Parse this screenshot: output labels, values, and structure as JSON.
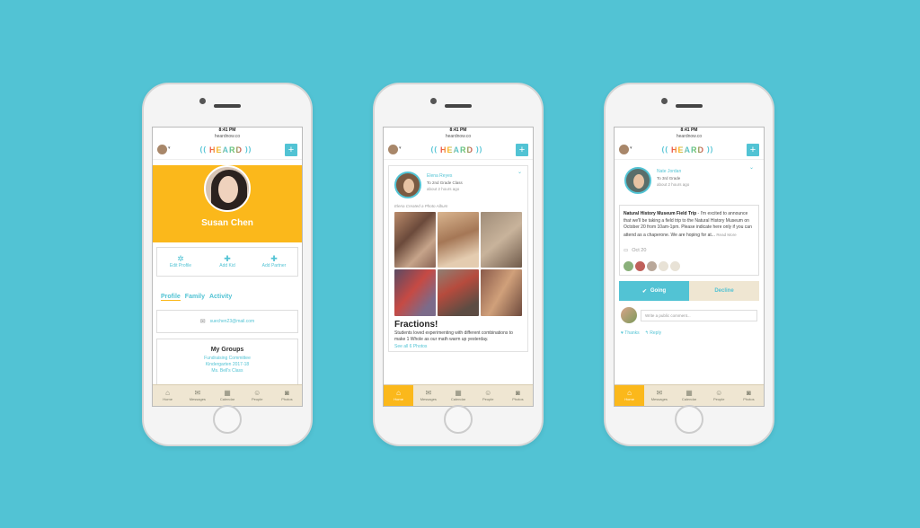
{
  "status": {
    "time": "8:41 PM",
    "url": "heardnow.co"
  },
  "logo": "HEARD",
  "plus_label": "+",
  "tabs": [
    {
      "label": "Home",
      "icon": "⌂"
    },
    {
      "label": "Messages",
      "icon": "✉"
    },
    {
      "label": "Calendar",
      "icon": "▦"
    },
    {
      "label": "People",
      "icon": "☺"
    },
    {
      "label": "Photos",
      "icon": "◙"
    }
  ],
  "profile": {
    "name": "Susan Chen",
    "actions": [
      {
        "label": "Edit Profile",
        "icon": "✲"
      },
      {
        "label": "Add Kid",
        "icon": "✚"
      },
      {
        "label": "Add Partner",
        "icon": "✚"
      }
    ],
    "tabs": [
      "Profile",
      "Family",
      "Activity"
    ],
    "email": "suechen23@mail.com",
    "groups_title": "My Groups",
    "groups": [
      "Fundraising Committee",
      "Kindergarten 2017-18",
      "Ms. Bell's Class"
    ]
  },
  "feed": {
    "author": "Elena Reyes",
    "audience": "To 2nd Grade Class",
    "time": "about 2 hours ago",
    "note": "Elena Created a Photo Album",
    "title": "Fractions!",
    "body": "Students loved experimenting with different combinations to make 1 Whole as our math warm up yesterday.",
    "see_all": "See all 6 Photos"
  },
  "event": {
    "author": "Nate Jordan",
    "audience": "To 3rd Grade",
    "time": "about 2 hours ago",
    "title": "Natural History Museum Field Trip",
    "body": " - I'm excited to announce that we'll be taking a field trip to the Natural History Museum on October 20 from 10am-1pm. Please indicate here only if you can attend as a chaperone. We are hoping for at...",
    "read_more": "Read More",
    "date": "Oct 20",
    "going": "Going",
    "decline": "Decline",
    "comment_placeholder": "Write a public comment...",
    "thanks": "Thanks",
    "reply": "Reply"
  },
  "colors": {
    "background": "#52c3d4",
    "accent": "#52c3d4",
    "brand_yellow": "#fbb81b",
    "tabbar": "#efe6d2"
  }
}
